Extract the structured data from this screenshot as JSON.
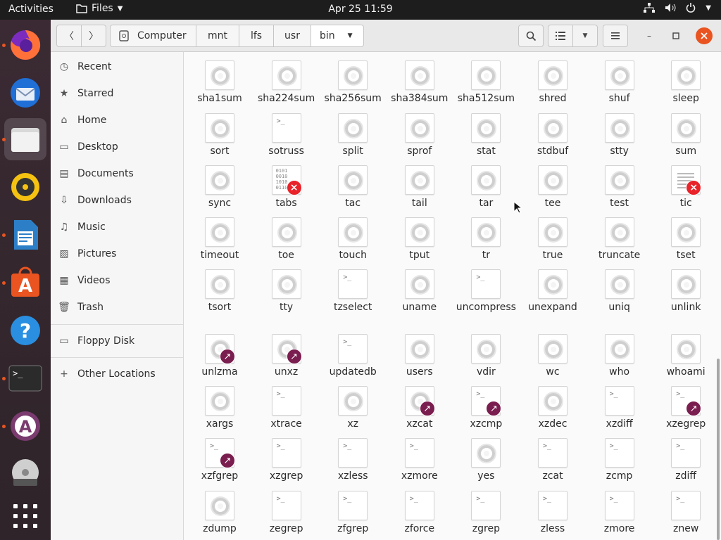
{
  "topbar": {
    "activities": "Activities",
    "app_name": "Files",
    "clock": "Apr 25  11:59"
  },
  "colors": {
    "accent": "#e95420",
    "symlink": "#7a1d4f",
    "broken": "#e8232a"
  },
  "breadcrumb": [
    "Computer",
    "mnt",
    "lfs",
    "usr",
    "bin"
  ],
  "sidebar": {
    "items": [
      {
        "icon": "recent-icon",
        "label": "Recent"
      },
      {
        "icon": "star-icon",
        "label": "Starred"
      },
      {
        "icon": "home-icon",
        "label": "Home"
      },
      {
        "icon": "desktop-icon",
        "label": "Desktop"
      },
      {
        "icon": "documents-icon",
        "label": "Documents"
      },
      {
        "icon": "downloads-icon",
        "label": "Downloads"
      },
      {
        "icon": "music-icon",
        "label": "Music"
      },
      {
        "icon": "pictures-icon",
        "label": "Pictures"
      },
      {
        "icon": "videos-icon",
        "label": "Videos"
      },
      {
        "icon": "trash-icon",
        "label": "Trash"
      }
    ],
    "devices": [
      {
        "icon": "floppy-icon",
        "label": "Floppy Disk"
      }
    ],
    "other": {
      "icon": "plus-icon",
      "label": "Other Locations"
    }
  },
  "files": {
    "rows": [
      [
        [
          "sha1sum",
          "exec"
        ],
        [
          "sha224sum",
          "exec"
        ],
        [
          "sha256sum",
          "exec"
        ],
        [
          "sha384sum",
          "exec"
        ],
        [
          "sha512sum",
          "exec"
        ],
        [
          "shred",
          "exec"
        ],
        [
          "shuf",
          "exec"
        ],
        [
          "sleep",
          "exec"
        ]
      ],
      [
        [
          "sort",
          "exec"
        ],
        [
          "sotruss",
          "script"
        ],
        [
          "split",
          "exec"
        ],
        [
          "sprof",
          "exec"
        ],
        [
          "stat",
          "exec"
        ],
        [
          "stdbuf",
          "exec"
        ],
        [
          "stty",
          "exec"
        ],
        [
          "sum",
          "exec"
        ]
      ],
      [
        [
          "sync",
          "exec"
        ],
        [
          "tabs",
          "binary-broken"
        ],
        [
          "tac",
          "exec"
        ],
        [
          "tail",
          "exec"
        ],
        [
          "tar",
          "exec"
        ],
        [
          "tee",
          "exec"
        ],
        [
          "test",
          "exec"
        ],
        [
          "tic",
          "doc-broken"
        ]
      ],
      [
        [
          "timeout",
          "exec"
        ],
        [
          "toe",
          "exec"
        ],
        [
          "touch",
          "exec"
        ],
        [
          "tput",
          "exec"
        ],
        [
          "tr",
          "exec"
        ],
        [
          "true",
          "exec"
        ],
        [
          "truncate",
          "exec"
        ],
        [
          "tset",
          "exec"
        ]
      ],
      [
        [
          "tsort",
          "exec"
        ],
        [
          "tty",
          "exec"
        ],
        [
          "tzselect",
          "script"
        ],
        [
          "uname",
          "exec"
        ],
        [
          "uncompress",
          "script"
        ],
        [
          "unexpand",
          "exec"
        ],
        [
          "uniq",
          "exec"
        ],
        [
          "unlink",
          "exec"
        ]
      ],
      [
        [
          "unlzma",
          "exec-link"
        ],
        [
          "unxz",
          "exec-link"
        ],
        [
          "updatedb",
          "script"
        ],
        [
          "users",
          "exec"
        ],
        [
          "vdir",
          "exec"
        ],
        [
          "wc",
          "exec"
        ],
        [
          "who",
          "exec"
        ],
        [
          "whoami",
          "exec"
        ]
      ],
      [
        [
          "xargs",
          "exec"
        ],
        [
          "xtrace",
          "script"
        ],
        [
          "xz",
          "exec"
        ],
        [
          "xzcat",
          "exec-link"
        ],
        [
          "xzcmp",
          "script-link"
        ],
        [
          "xzdec",
          "exec"
        ],
        [
          "xzdiff",
          "script"
        ],
        [
          "xzegrep",
          "script-link"
        ]
      ],
      [
        [
          "xzfgrep",
          "script-link"
        ],
        [
          "xzgrep",
          "script"
        ],
        [
          "xzless",
          "script"
        ],
        [
          "xzmore",
          "script"
        ],
        [
          "yes",
          "exec"
        ],
        [
          "zcat",
          "script"
        ],
        [
          "zcmp",
          "script"
        ],
        [
          "zdiff",
          "script"
        ]
      ],
      [
        [
          "zdump",
          "exec"
        ],
        [
          "zegrep",
          "script"
        ],
        [
          "zfgrep",
          "script"
        ],
        [
          "zforce",
          "script"
        ],
        [
          "zgrep",
          "script"
        ],
        [
          "zless",
          "script"
        ],
        [
          "zmore",
          "script"
        ],
        [
          "znew",
          "script"
        ]
      ]
    ]
  }
}
